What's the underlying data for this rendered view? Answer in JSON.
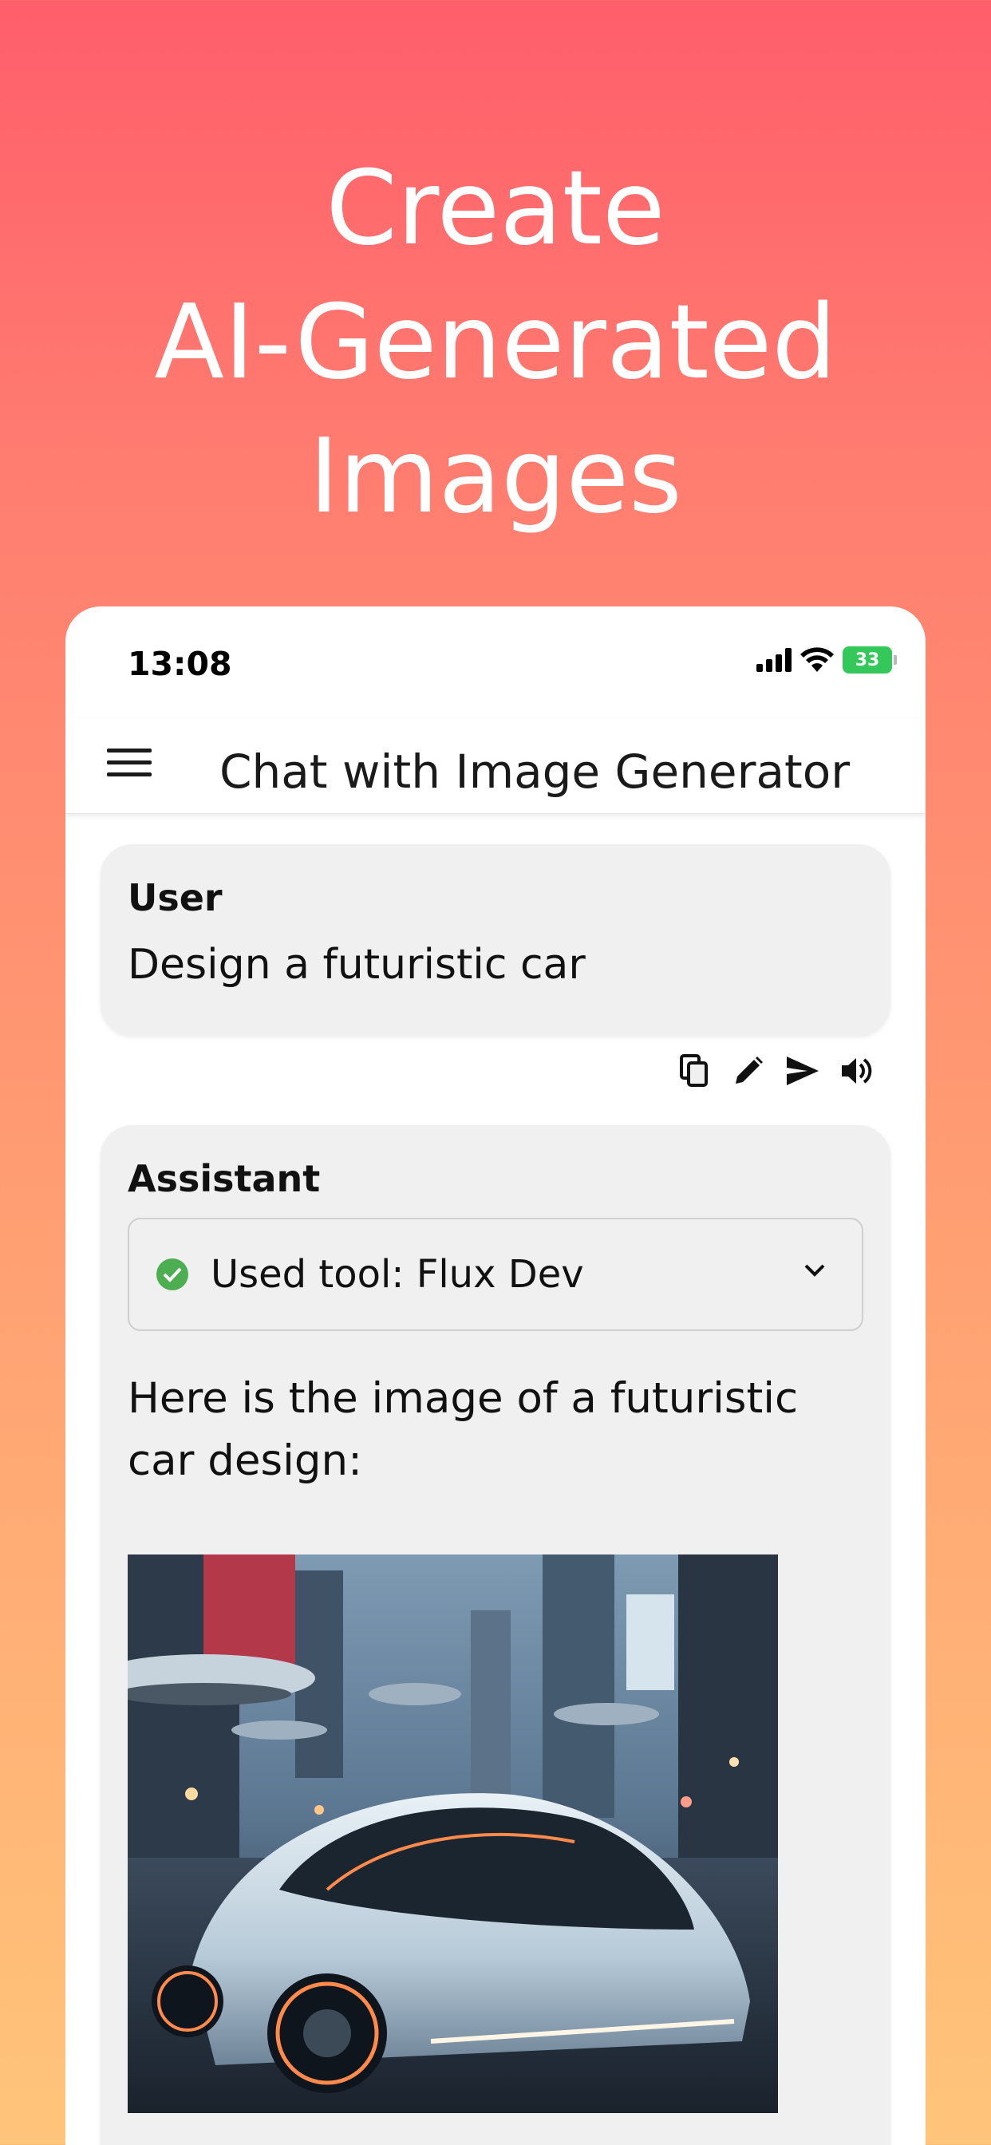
{
  "headline": {
    "line1": "Create",
    "line2": "AI-Generated",
    "line3": "Images"
  },
  "status_bar": {
    "time": "13:08",
    "battery": "33"
  },
  "app_bar": {
    "title": "Chat with Image Generator"
  },
  "messages": [
    {
      "role": "User",
      "text": "Design a futuristic car"
    },
    {
      "role": "Assistant",
      "tool_label": "Used tool: Flux Dev",
      "text": "Here is the image of a futuristic car design:"
    }
  ],
  "colors": {
    "accent_check": "#4cae50",
    "battery": "#34c759"
  },
  "icons": {
    "menu": "hamburger-icon",
    "copy": "copy-icon",
    "edit": "pencil-icon",
    "send": "send-icon",
    "speaker": "speaker-icon",
    "check": "check-circle-icon",
    "chevron": "chevron-down-icon"
  }
}
